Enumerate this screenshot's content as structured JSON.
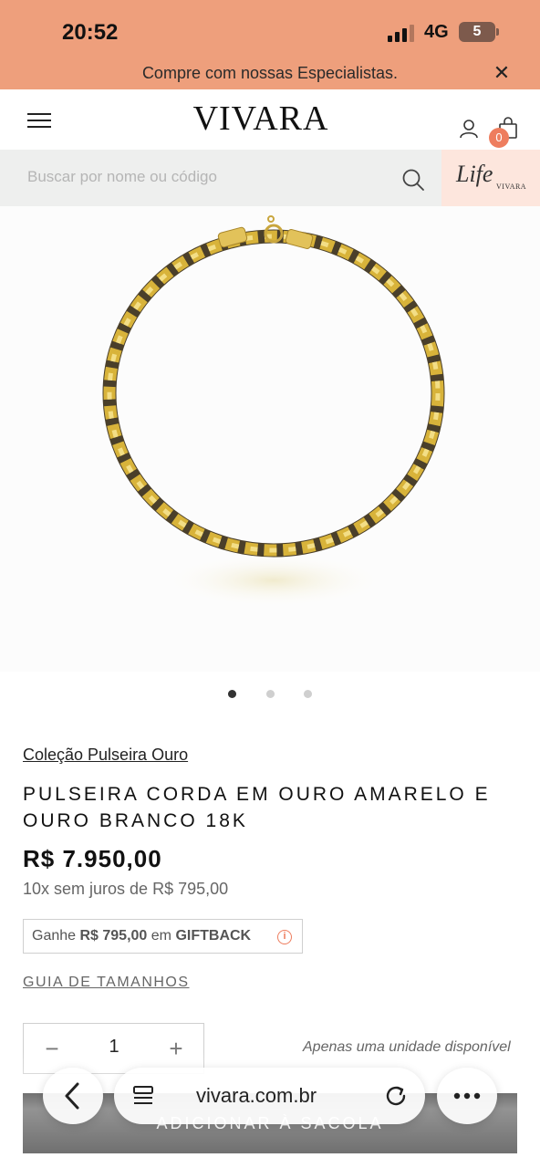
{
  "status_bar": {
    "time": "20:52",
    "network": "4G",
    "battery": "5"
  },
  "promo": {
    "text": "Compre com nossas Especialistas.",
    "close_icon": "close-icon"
  },
  "header": {
    "logo": "VIVARA",
    "cart_count": "0",
    "icons": [
      "menu-icon",
      "user-icon",
      "shopping-bag-icon"
    ]
  },
  "search": {
    "placeholder": "Buscar por nome ou código",
    "icon": "search-icon"
  },
  "life_banner": {
    "title": "Life",
    "subtitle": "VIVARA"
  },
  "carousel": {
    "slide_count": 3,
    "active_index": 0
  },
  "product": {
    "collection": "Coleção Pulseira Ouro",
    "title": "PULSEIRA CORDA EM OURO AMARELO E OURO BRANCO 18K",
    "price": "R$ 7.950,00",
    "installments": "10x sem juros de R$ 795,00",
    "giftback_prefix": "Ganhe ",
    "giftback_amount": "R$ 795,00",
    "giftback_middle": " em ",
    "giftback_label": "GIFTBACK",
    "size_guide": "GUIA DE TAMANHOS"
  },
  "quantity": {
    "minus": "−",
    "value": "1",
    "plus": "+",
    "stock_note": "Apenas uma unidade disponível"
  },
  "add_button": {
    "label": "ADICIONAR À SACOLA"
  },
  "browser": {
    "url": "vivara.com.br"
  },
  "colors": {
    "promo_background": "#ee9f7c",
    "accent": "#ee7d5e",
    "search_background": "#eeefee",
    "life_background": "#fde6dd",
    "gold": "#d8b33a"
  }
}
